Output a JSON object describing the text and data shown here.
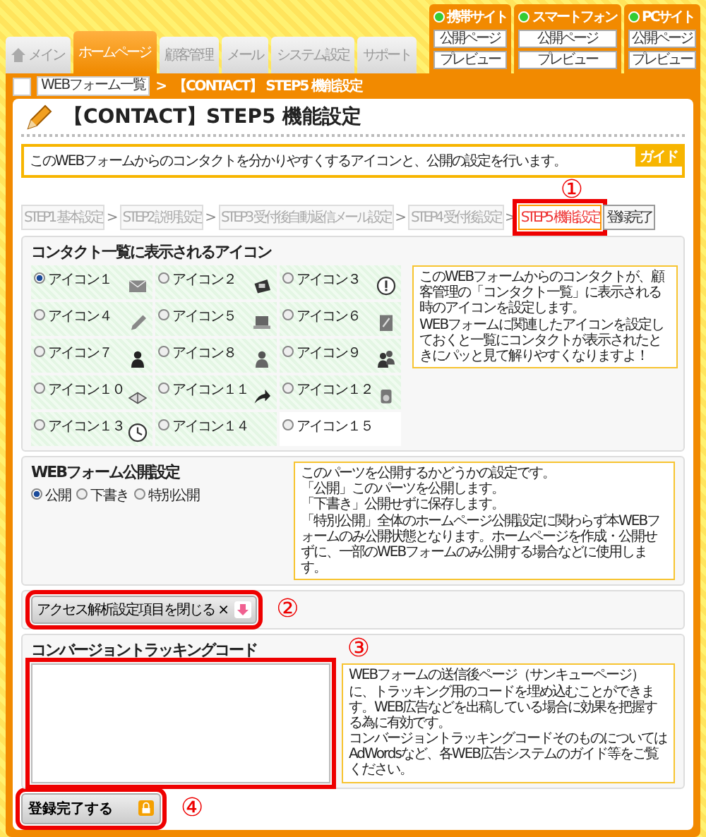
{
  "top_tabs": [
    {
      "label": "メイン",
      "selected": false
    },
    {
      "label": "ホームページ",
      "selected": true
    },
    {
      "label": "顧客管理",
      "selected": false
    },
    {
      "label": "メール",
      "selected": false
    },
    {
      "label": "システム設定",
      "selected": false
    },
    {
      "label": "サポート",
      "selected": false
    }
  ],
  "site_panels": [
    {
      "label": "携帯サイト",
      "buttons": [
        "公開ページ",
        "プレビュー"
      ]
    },
    {
      "label": "スマートフォン",
      "buttons": [
        "公開ページ",
        "プレビュー"
      ]
    },
    {
      "label": "PCサイト",
      "buttons": [
        "公開ページ",
        "プレビュー"
      ]
    }
  ],
  "breadcrumb": {
    "items": [
      "WEBフォーム一覧"
    ],
    "separator": ">",
    "current": "【CONTACT】 STEP5 機能設定"
  },
  "page_title": "【CONTACT】STEP5 機能設定",
  "guide": {
    "text": "このWEBフォームからのコンタクトを分かりやすくするアイコンと、公開の設定を行います。",
    "badge": "ガイド"
  },
  "steps": [
    {
      "label": "STEP1 基本設定",
      "selected": false,
      "separator": ">"
    },
    {
      "label": "STEP2 説明設定",
      "selected": false,
      "separator": ">"
    },
    {
      "label": "STEP3 受付後自動返信メール設定",
      "selected": false,
      "separator": ">"
    },
    {
      "label": "STEP4 受付後設定",
      "selected": false,
      "separator": ">"
    },
    {
      "label": "STEP5 機能設定",
      "selected": true,
      "marker": "①"
    },
    {
      "label": "登録完了",
      "selected": false
    }
  ],
  "icon_section": {
    "heading": "コンタクト一覧に表示されるアイコン",
    "options": [
      {
        "label": "アイコン１",
        "selected": true
      },
      {
        "label": "アイコン２",
        "selected": false
      },
      {
        "label": "アイコン３",
        "selected": false
      },
      {
        "label": "アイコン４",
        "selected": false
      },
      {
        "label": "アイコン５",
        "selected": false
      },
      {
        "label": "アイコン６",
        "selected": false
      },
      {
        "label": "アイコン７",
        "selected": false
      },
      {
        "label": "アイコン８",
        "selected": false
      },
      {
        "label": "アイコン９",
        "selected": false
      },
      {
        "label": "アイコン１０",
        "selected": false
      },
      {
        "label": "アイコン１１",
        "selected": false
      },
      {
        "label": "アイコン１２",
        "selected": false
      },
      {
        "label": "アイコン１３",
        "selected": false
      },
      {
        "label": "アイコン１４",
        "selected": false
      },
      {
        "label": "アイコン１５",
        "selected": false
      }
    ],
    "help": [
      "このWEBフォームからのコンタクトが、顧客管理の「コンタクト一覧」に表示される時のアイコンを設定します。",
      "WEBフォームに関連したアイコンを設定しておくと一覧にコンタクトが表示されたときにパッと見て解りやすくなりますよ！"
    ]
  },
  "publish_section": {
    "heading": "WEBフォーム公開設定",
    "options": [
      {
        "label": "公開",
        "selected": true
      },
      {
        "label": "下書き",
        "selected": false
      },
      {
        "label": "特別公開",
        "selected": false
      }
    ],
    "help": [
      "このパーツを公開するかどうかの設定です。",
      "「公開」このパーツを公開します。",
      "「下書き」公開せずに保存します。",
      "「特別公開」全体のホームページ公開設定に関わらず本WEBフォームのみ公開状態となります。ホームページを作成・公開せずに、一部のWEBフォームのみ公開する場合などに使用します。"
    ]
  },
  "access_toggle": {
    "label": "アクセス解析設定項目を閉じる ×",
    "marker": "②"
  },
  "conversion_section": {
    "heading": "コンバージョントラッキングコード",
    "marker": "③",
    "help": [
      "WEBフォームの送信後ページ（サンキューページ）に、トラッキング用のコードを埋め込むことができます。WEB広告などを出稿している場合に効果を把握する為に有効です。",
      "コンバージョントラッキングコードそのものについてはAdWordsなど、各WEB広告システムのガイド等をご覧ください。"
    ]
  },
  "submit": {
    "label": "登録完了する",
    "marker": "④"
  }
}
